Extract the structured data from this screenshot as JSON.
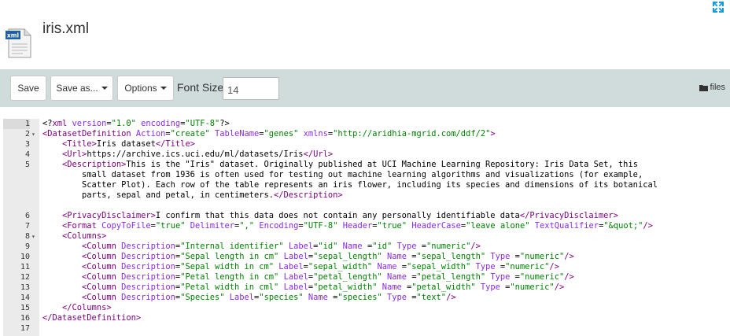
{
  "file": {
    "title": "iris.xml",
    "icon_name": "xml-file-icon",
    "icon_text": "xml"
  },
  "toolbar": {
    "save_label": "Save",
    "save_as_label": "Save as...",
    "options_label": "Options",
    "font_size_label": "Font Size",
    "font_size_value": "14",
    "files_label": "files",
    "files_icon": "folder-icon"
  },
  "editor": {
    "active_line": 1,
    "lines": [
      {
        "n": "1",
        "fold": ""
      },
      {
        "n": "2",
        "fold": "▾"
      },
      {
        "n": "3",
        "fold": ""
      },
      {
        "n": "4",
        "fold": ""
      },
      {
        "n": "5",
        "fold": ""
      },
      {
        "n": "",
        "fold": ""
      },
      {
        "n": "",
        "fold": ""
      },
      {
        "n": "",
        "fold": ""
      },
      {
        "n": "",
        "fold": ""
      },
      {
        "n": "6",
        "fold": ""
      },
      {
        "n": "7",
        "fold": ""
      },
      {
        "n": "8",
        "fold": "▾"
      },
      {
        "n": "9",
        "fold": ""
      },
      {
        "n": "10",
        "fold": ""
      },
      {
        "n": "11",
        "fold": ""
      },
      {
        "n": "12",
        "fold": ""
      },
      {
        "n": "13",
        "fold": ""
      },
      {
        "n": "14",
        "fold": ""
      },
      {
        "n": "15",
        "fold": ""
      },
      {
        "n": "16",
        "fold": ""
      },
      {
        "n": "17",
        "fold": ""
      }
    ],
    "code": [
      [
        [
          "xml-decl",
          "<?"
        ],
        [
          "tag",
          "xml"
        ],
        [
          "attr",
          " version"
        ],
        [
          "txt",
          "="
        ],
        [
          "val",
          "\"1.0\""
        ],
        [
          "attr",
          " encoding"
        ],
        [
          "txt",
          "="
        ],
        [
          "val",
          "\"UTF-8\""
        ],
        [
          "xml-decl",
          "?>"
        ]
      ],
      [
        [
          "tag",
          "<DatasetDefinition"
        ],
        [
          "attr",
          " Action"
        ],
        [
          "txt",
          "="
        ],
        [
          "val",
          "\"create\""
        ],
        [
          "attr",
          " TableName"
        ],
        [
          "txt",
          "="
        ],
        [
          "val",
          "\"genes\""
        ],
        [
          "attr",
          " xmlns"
        ],
        [
          "txt",
          "="
        ],
        [
          "val",
          "\"http://aridhia-mgrid.com/ddf/2\""
        ],
        [
          "tag",
          ">"
        ]
      ],
      [
        [
          "txt",
          "    "
        ],
        [
          "tag",
          "<Title>"
        ],
        [
          "txt",
          "Iris dataset"
        ],
        [
          "tag",
          "</Title>"
        ]
      ],
      [
        [
          "txt",
          "    "
        ],
        [
          "tag",
          "<Url>"
        ],
        [
          "txt",
          "https://archive.ics.uci.edu/ml/datasets/Iris"
        ],
        [
          "tag",
          "</Url>"
        ]
      ],
      [
        [
          "txt",
          "    "
        ],
        [
          "tag",
          "<Description>"
        ],
        [
          "txt",
          "This is the \"Iris\" dataset. Originally published at UCI Machine Learning Repository: Iris Data Set, this"
        ]
      ],
      [
        [
          "txt",
          "        small dataset from 1936 is often used for testing out machine learning algorithms and visualizations (for example,"
        ]
      ],
      [
        [
          "txt",
          "        Scatter Plot). Each row of the table represents an iris flower, including its species and dimensions of its botanical"
        ]
      ],
      [
        [
          "txt",
          "        parts, sepal and petal, in centimeters."
        ],
        [
          "tag",
          "</Description>"
        ]
      ],
      [],
      [
        [
          "txt",
          "    "
        ],
        [
          "tag",
          "<PrivacyDisclaimer>"
        ],
        [
          "txt",
          "I confirm that this data does not contain any personally identifiable data"
        ],
        [
          "tag",
          "</PrivacyDisclaimer>"
        ]
      ],
      [
        [
          "txt",
          "    "
        ],
        [
          "tag",
          "<Format"
        ],
        [
          "attr",
          " CopyToFile"
        ],
        [
          "txt",
          "="
        ],
        [
          "val",
          "\"true\""
        ],
        [
          "attr",
          " Delimiter"
        ],
        [
          "txt",
          "="
        ],
        [
          "val",
          "\",\""
        ],
        [
          "attr",
          " Encoding"
        ],
        [
          "txt",
          "="
        ],
        [
          "val",
          "\"UTF-8\""
        ],
        [
          "attr",
          " Header"
        ],
        [
          "txt",
          "="
        ],
        [
          "val",
          "\"true\""
        ],
        [
          "attr",
          " HeaderCase"
        ],
        [
          "txt",
          "="
        ],
        [
          "val",
          "\"leave alone\""
        ],
        [
          "attr",
          " TextQualifier"
        ],
        [
          "txt",
          "="
        ],
        [
          "val",
          "\"&quot;\""
        ],
        [
          "tag",
          "/>"
        ]
      ],
      [
        [
          "txt",
          "    "
        ],
        [
          "tag",
          "<Columns>"
        ]
      ],
      [
        [
          "txt",
          "        "
        ],
        [
          "tag",
          "<Column"
        ],
        [
          "attr",
          " Description"
        ],
        [
          "txt",
          "="
        ],
        [
          "val",
          "\"Internal identifier\""
        ],
        [
          "attr",
          " Label"
        ],
        [
          "txt",
          "="
        ],
        [
          "val",
          "\"id\""
        ],
        [
          "attr",
          " Name"
        ],
        [
          "txt",
          " ="
        ],
        [
          "val",
          "\"id\""
        ],
        [
          "attr",
          " Type"
        ],
        [
          "txt",
          " ="
        ],
        [
          "val",
          "\"numeric\""
        ],
        [
          "tag",
          "/>"
        ]
      ],
      [
        [
          "txt",
          "        "
        ],
        [
          "tag",
          "<Column"
        ],
        [
          "attr",
          " Description"
        ],
        [
          "txt",
          "="
        ],
        [
          "val",
          "\"Sepal length in cm\""
        ],
        [
          "attr",
          " Label"
        ],
        [
          "txt",
          "="
        ],
        [
          "val",
          "\"sepal_length\""
        ],
        [
          "attr",
          " Name"
        ],
        [
          "txt",
          " ="
        ],
        [
          "val",
          "\"sepal_length\""
        ],
        [
          "attr",
          " Type"
        ],
        [
          "txt",
          " ="
        ],
        [
          "val",
          "\"numeric\""
        ],
        [
          "tag",
          "/>"
        ]
      ],
      [
        [
          "txt",
          "        "
        ],
        [
          "tag",
          "<Column"
        ],
        [
          "attr",
          " Description"
        ],
        [
          "txt",
          "="
        ],
        [
          "val",
          "\"Sepal width in cm\""
        ],
        [
          "attr",
          " Label"
        ],
        [
          "txt",
          "="
        ],
        [
          "val",
          "\"sepal_width\""
        ],
        [
          "attr",
          " Name"
        ],
        [
          "txt",
          " ="
        ],
        [
          "val",
          "\"sepal_width\""
        ],
        [
          "attr",
          " Type"
        ],
        [
          "txt",
          " ="
        ],
        [
          "val",
          "\"numeric\""
        ],
        [
          "tag",
          "/>"
        ]
      ],
      [
        [
          "txt",
          "        "
        ],
        [
          "tag",
          "<Column"
        ],
        [
          "attr",
          " Description"
        ],
        [
          "txt",
          "="
        ],
        [
          "val",
          "\"Petal length in cm\""
        ],
        [
          "attr",
          " Label"
        ],
        [
          "txt",
          "="
        ],
        [
          "val",
          "\"petal_length\""
        ],
        [
          "attr",
          " Name"
        ],
        [
          "txt",
          " ="
        ],
        [
          "val",
          "\"petal_length\""
        ],
        [
          "attr",
          " Type"
        ],
        [
          "txt",
          " ="
        ],
        [
          "val",
          "\"numeric\""
        ],
        [
          "tag",
          "/>"
        ]
      ],
      [
        [
          "txt",
          "        "
        ],
        [
          "tag",
          "<Column"
        ],
        [
          "attr",
          " Description"
        ],
        [
          "txt",
          "="
        ],
        [
          "val",
          "\"Petal width in cml\""
        ],
        [
          "attr",
          " Label"
        ],
        [
          "txt",
          "="
        ],
        [
          "val",
          "\"petal_width\""
        ],
        [
          "attr",
          " Name"
        ],
        [
          "txt",
          " ="
        ],
        [
          "val",
          "\"petal_width\""
        ],
        [
          "attr",
          " Type"
        ],
        [
          "txt",
          " ="
        ],
        [
          "val",
          "\"numeric\""
        ],
        [
          "tag",
          "/>"
        ]
      ],
      [
        [
          "txt",
          "        "
        ],
        [
          "tag",
          "<Column"
        ],
        [
          "attr",
          " Description"
        ],
        [
          "txt",
          "="
        ],
        [
          "val",
          "\"Species\""
        ],
        [
          "attr",
          " Label"
        ],
        [
          "txt",
          "="
        ],
        [
          "val",
          "\"species\""
        ],
        [
          "attr",
          " Name"
        ],
        [
          "txt",
          " ="
        ],
        [
          "val",
          "\"species\""
        ],
        [
          "attr",
          " Type"
        ],
        [
          "txt",
          " ="
        ],
        [
          "val",
          "\"text\""
        ],
        [
          "tag",
          "/>"
        ]
      ],
      [
        [
          "txt",
          "    "
        ],
        [
          "tag",
          "</Columns>"
        ]
      ],
      [
        [
          "tag",
          "</DatasetDefinition>"
        ]
      ],
      []
    ]
  },
  "colors": {
    "toolbar_bg": "#cfdcdb",
    "gutter_bg": "#ebebeb",
    "tag": "#800080",
    "attr": "#8a2be2",
    "value": "#008000",
    "expand_icon": "#1a9ad6"
  }
}
